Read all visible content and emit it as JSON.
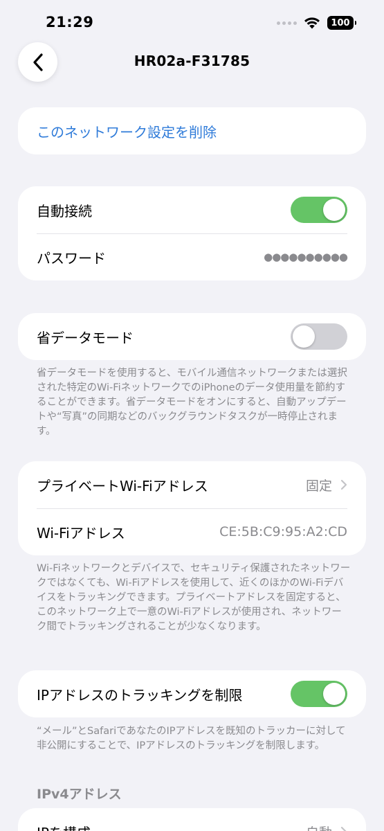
{
  "status_bar": {
    "time": "21:29",
    "battery": "100"
  },
  "nav": {
    "title": "HR02a-F31785"
  },
  "forget": {
    "label": "このネットワーク設定を削除"
  },
  "auto_join": {
    "label": "自動接続",
    "on": true
  },
  "password": {
    "label": "パスワード",
    "masked_value": "●●●●●●●●●●"
  },
  "low_data_mode": {
    "label": "省データモード",
    "on": false,
    "footnote": "省データモードを使用すると、モバイル通信ネットワークまたは選択された特定のWi-FiネットワークでのiPhoneのデータ使用量を節約することができます。省データモードをオンにすると、自動アップデートや“写真”の同期などのバックグラウンドタスクが一時停止されます。"
  },
  "private_address": {
    "label": "プライベートWi-Fiアドレス",
    "value": "固定",
    "wifi_address_label": "Wi-Fiアドレス",
    "wifi_address_value": "CE:5B:C9:95:A2:CD",
    "footnote": "Wi-Fiネットワークとデバイスで、セキュリティ保護されたネットワークではなくても、Wi-Fiアドレスを使用して、近くのほかのWi-Fiデバイスをトラッキングできます。プライベートアドレスを固定すると、このネットワーク上で一意のWi-Fiアドレスが使用され、ネットワーク間でトラッキングされることが少なくなります。"
  },
  "ip_tracking": {
    "label": "IPアドレスのトラッキングを制限",
    "on": true,
    "footnote": "“メール”とSafariであなたのIPアドレスを既知のトラッカーに対して非公開にすることで、IPアドレスのトラッキングを制限します。"
  },
  "ipv4": {
    "header": "IPv4アドレス",
    "configure_label": "IPを構成",
    "configure_value": "自動"
  },
  "colors": {
    "accent": "#2f7bd9",
    "toggle_on": "#65c466",
    "toggle_off": "#d1d1d6",
    "background": "#f2f2f7"
  }
}
